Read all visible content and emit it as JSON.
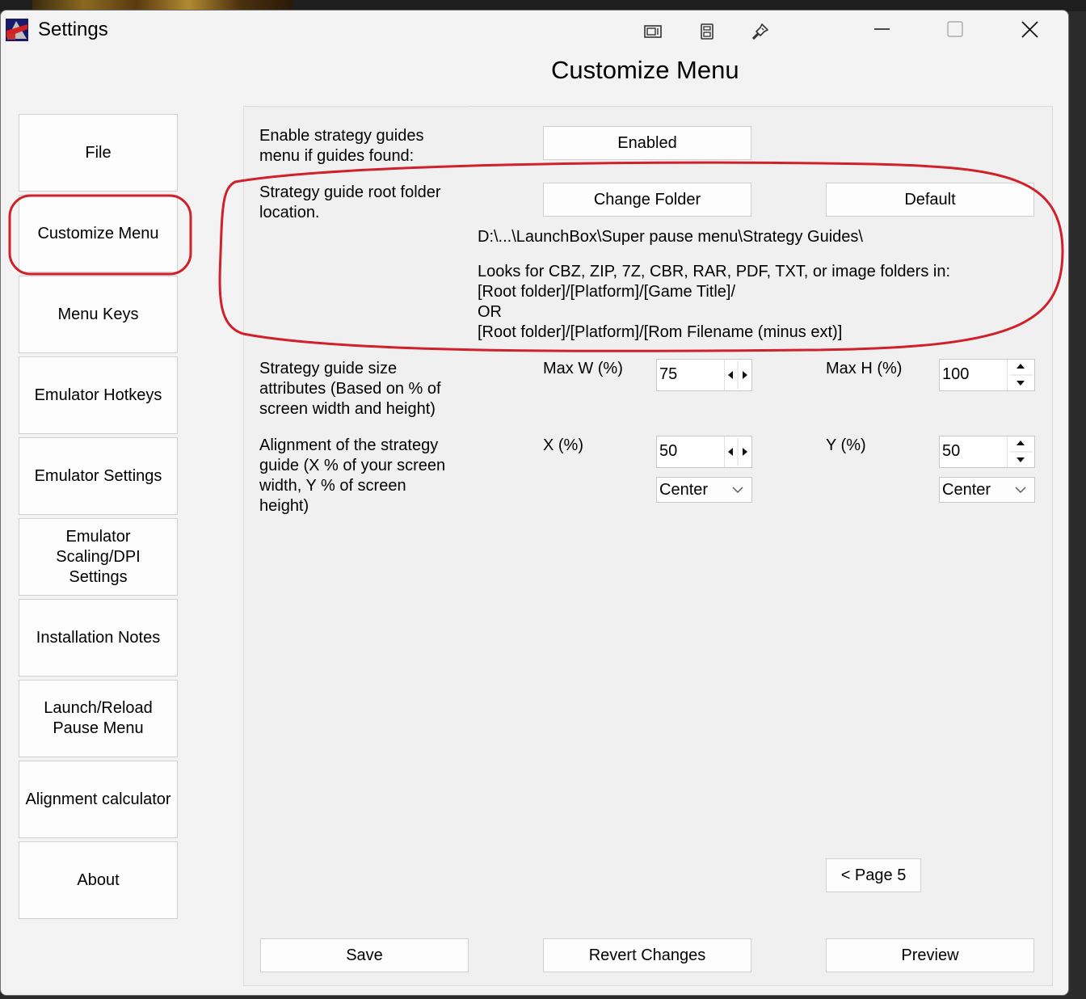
{
  "window": {
    "title": "Settings",
    "icons": [
      "app-icon",
      "window-layout-icon",
      "calculator-icon",
      "pin-icon"
    ],
    "controls": [
      "minimize-icon",
      "maximize-icon",
      "close-icon"
    ]
  },
  "page": {
    "heading": "Customize Menu"
  },
  "sidebar": {
    "items": [
      {
        "label": "File"
      },
      {
        "label": "Customize Menu",
        "selected": true
      },
      {
        "label": "Menu Keys"
      },
      {
        "label": "Emulator Hotkeys"
      },
      {
        "label": "Emulator Settings"
      },
      {
        "label": "Emulator\nScaling/DPI\nSettings"
      },
      {
        "label": "Installation Notes"
      },
      {
        "label": "Launch/Reload\nPause Menu"
      },
      {
        "label": "Alignment calculator"
      },
      {
        "label": "About"
      }
    ]
  },
  "settings": {
    "guides_menu": {
      "label": "Enable strategy guides\nmenu if guides found:",
      "button": "Enabled"
    },
    "root_folder": {
      "label": "Strategy guide root folder\nlocation.",
      "change_button": "Change Folder",
      "default_button": "Default",
      "path": "D:\\...\\LaunchBox\\Super pause menu\\Strategy Guides\\",
      "help": "Looks for CBZ, ZIP, 7Z, CBR, RAR, PDF, TXT, or image folders in:\n [Root folder]/[Platform]/[Game Title]/\n OR\n [Root folder]/[Platform]/[Rom Filename (minus ext)]"
    },
    "size": {
      "label": "Strategy guide size\nattributes (Based on % of\nscreen width and height)",
      "max_w_label": "Max W (%)",
      "max_w_value": "75",
      "max_h_label": "Max H (%)",
      "max_h_value": "100"
    },
    "alignment": {
      "label": "Alignment of the strategy\nguide (X % of your screen\nwidth, Y % of screen\nheight)",
      "x_label": "X (%)",
      "x_value": "50",
      "x_align": "Center",
      "y_label": "Y (%)",
      "y_value": "50",
      "y_align": "Center"
    }
  },
  "pager": {
    "label": "< Page 5"
  },
  "footer": {
    "save": "Save",
    "revert": "Revert Changes",
    "preview": "Preview"
  },
  "colors": {
    "annotation": "#d0202a",
    "window_bg": "#f3f3f3",
    "button_bg": "#fdfdfd"
  }
}
